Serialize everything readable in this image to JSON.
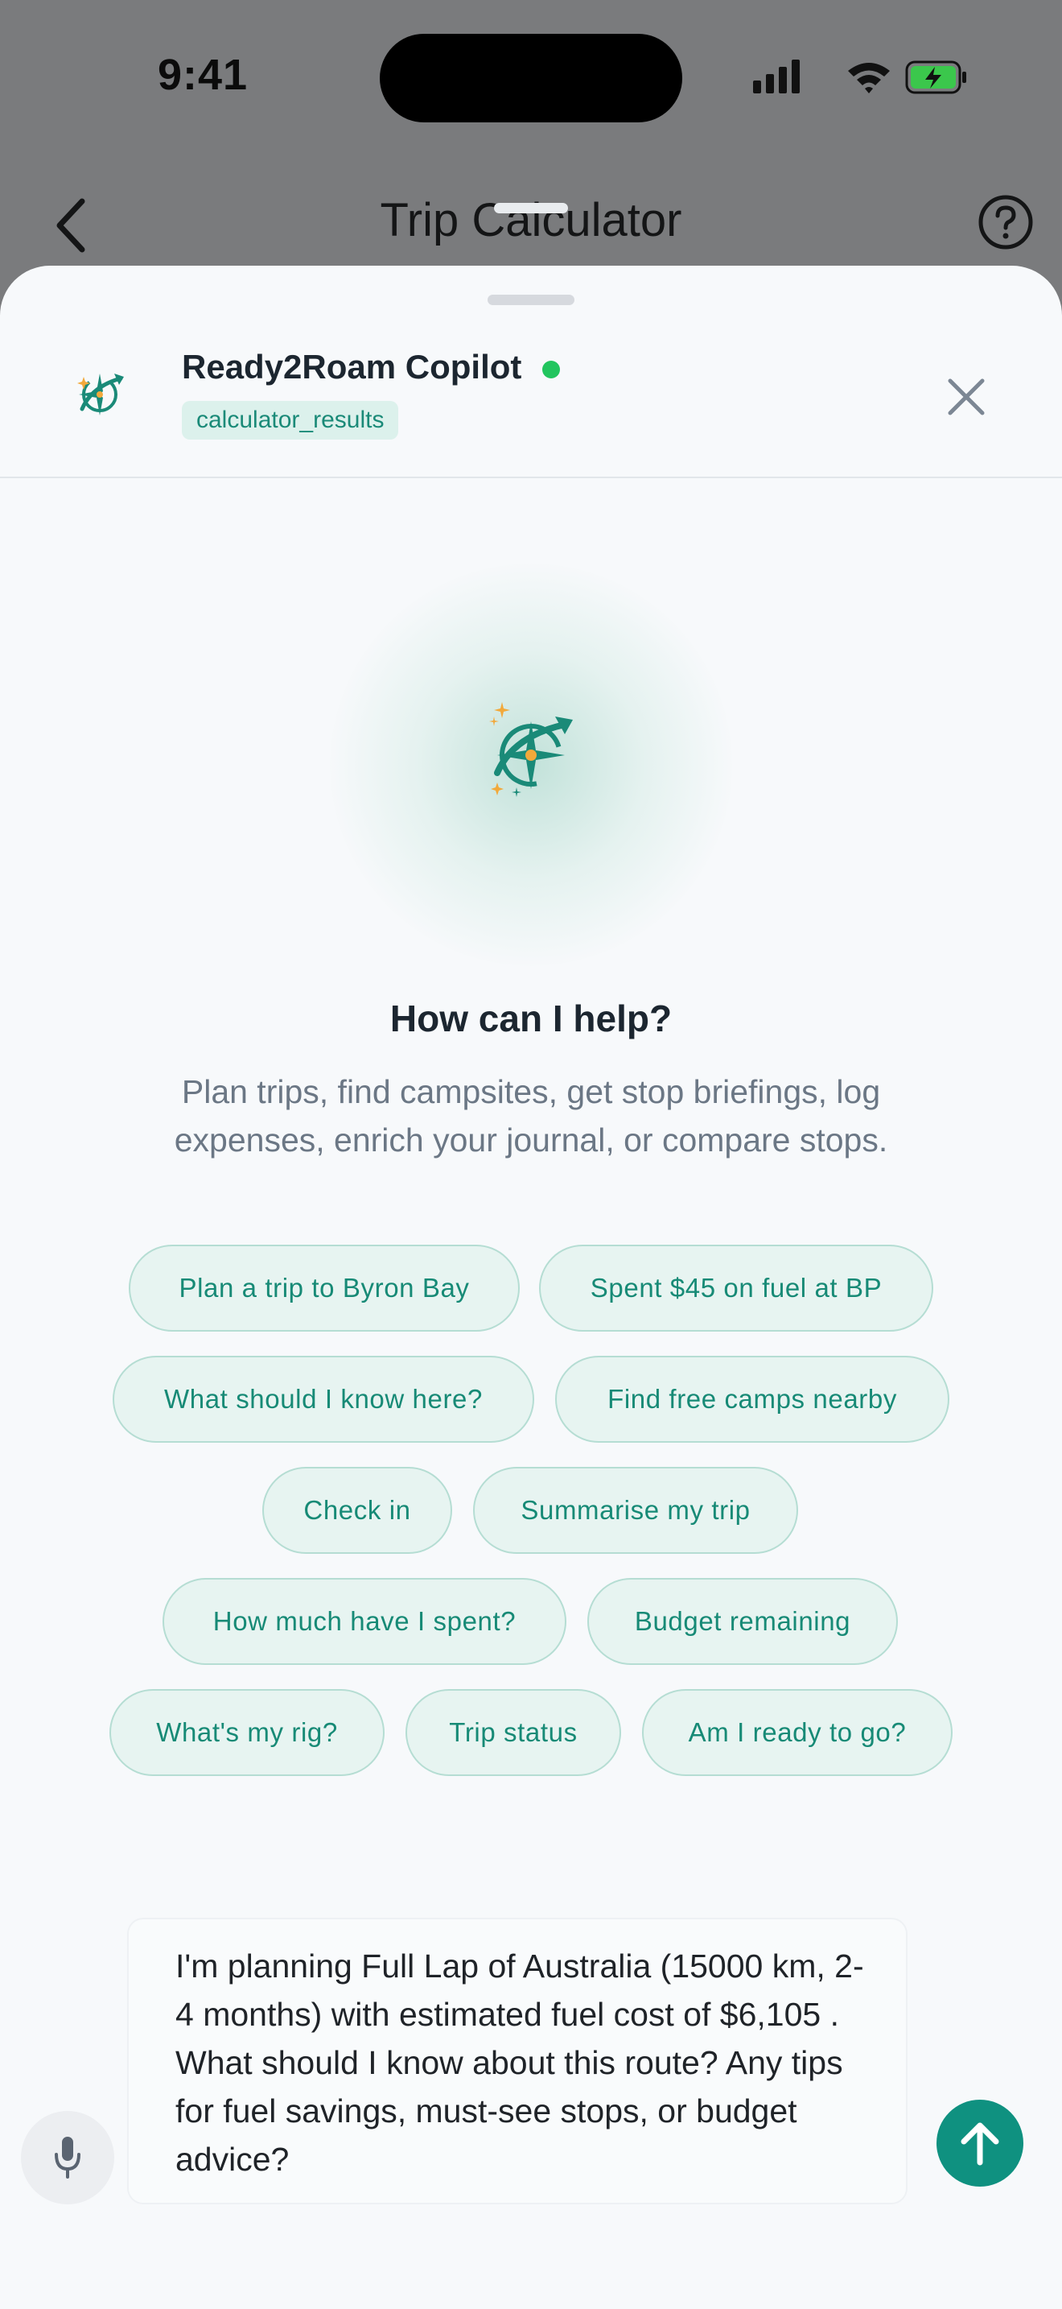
{
  "status_bar": {
    "time": "9:41"
  },
  "nav": {
    "title": "Trip Calculator"
  },
  "copilot": {
    "name": "Ready2Roam Copilot",
    "context": "calculator_results",
    "status_color": "#22c55e"
  },
  "empty_state": {
    "title": "How can I help?",
    "subtitle": "Plan trips, find campsites, get stop briefings, log expenses, enrich your journal, or compare stops."
  },
  "suggestions": [
    "Plan a trip to Byron Bay",
    "Spent $45 on fuel at BP",
    "What should I know here?",
    "Find free camps nearby",
    "Check in",
    "Summarise my trip",
    "How much have I spent?",
    "Budget remaining",
    "What's my rig?",
    "Trip status",
    "Am I ready to go?"
  ],
  "composer": {
    "value": "I'm planning Full Lap of Australia (15000 km, 2-4 months) with estimated fuel cost of $6,105 . What should I know about this route? Any tips for fuel savings, must-see stops, or budget advice?"
  },
  "colors": {
    "accent": "#0f9180",
    "chip_bg": "#e7f4f1",
    "chip_text": "#178a76",
    "compass_gold": "#f2a93b"
  },
  "icons": {
    "back": "chevron-left-icon",
    "help": "question-circle-icon",
    "close": "close-icon",
    "logo": "compass-route-icon",
    "mic": "microphone-icon",
    "send": "arrow-up-icon"
  }
}
